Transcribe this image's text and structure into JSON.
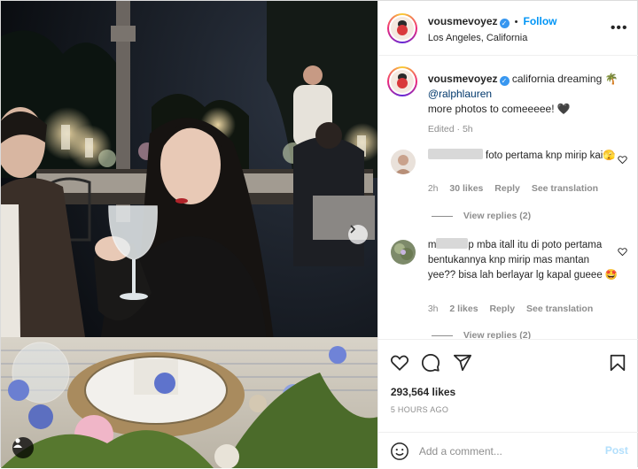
{
  "post": {
    "username": "vousmevoyez",
    "follow_label": "Follow",
    "location": "Los Angeles, California",
    "more_label": "•••",
    "caption": {
      "username": "vousmevoyez",
      "text_before": "california dreaming",
      "emoji": "🌴",
      "mention": "@ralphlauren",
      "text_after": "more photos to comeeeee!",
      "heart": "🖤",
      "edited": "Edited",
      "time": "5h"
    },
    "comments": [
      {
        "name_visible": "",
        "text": "foto pertama knp mirip kai🫣",
        "time": "2h",
        "likes": "30 likes",
        "reply": "Reply",
        "see_translation": "See translation",
        "view_replies": "View replies (2)"
      },
      {
        "name_visible": "m",
        "name_tail": "p",
        "text": "mba itall itu di poto pertama bentukannya knp mirip mas mantan yee?? bisa lah berlayar lg kapal gueee 🤩",
        "time": "3h",
        "likes": "2 likes",
        "reply": "Reply",
        "see_translation": "See translation",
        "view_replies": "View replies (2)"
      }
    ],
    "likes": "293,564 likes",
    "time_ago": "5 HOURS AGO",
    "add_comment_placeholder": "Add a comment...",
    "post_label": "Post",
    "verified_badge": "✓",
    "colors": {
      "link_blue": "#0095f6",
      "mention_blue": "#00376b",
      "muted": "#8e8e8e",
      "post_disabled": "#b2dffc",
      "verified": "#3897f0"
    },
    "icons": [
      "heart-icon",
      "comment-icon",
      "share-icon",
      "bookmark-icon",
      "emoji-icon",
      "more-icon",
      "carousel-next-icon",
      "user-tag-icon"
    ]
  }
}
